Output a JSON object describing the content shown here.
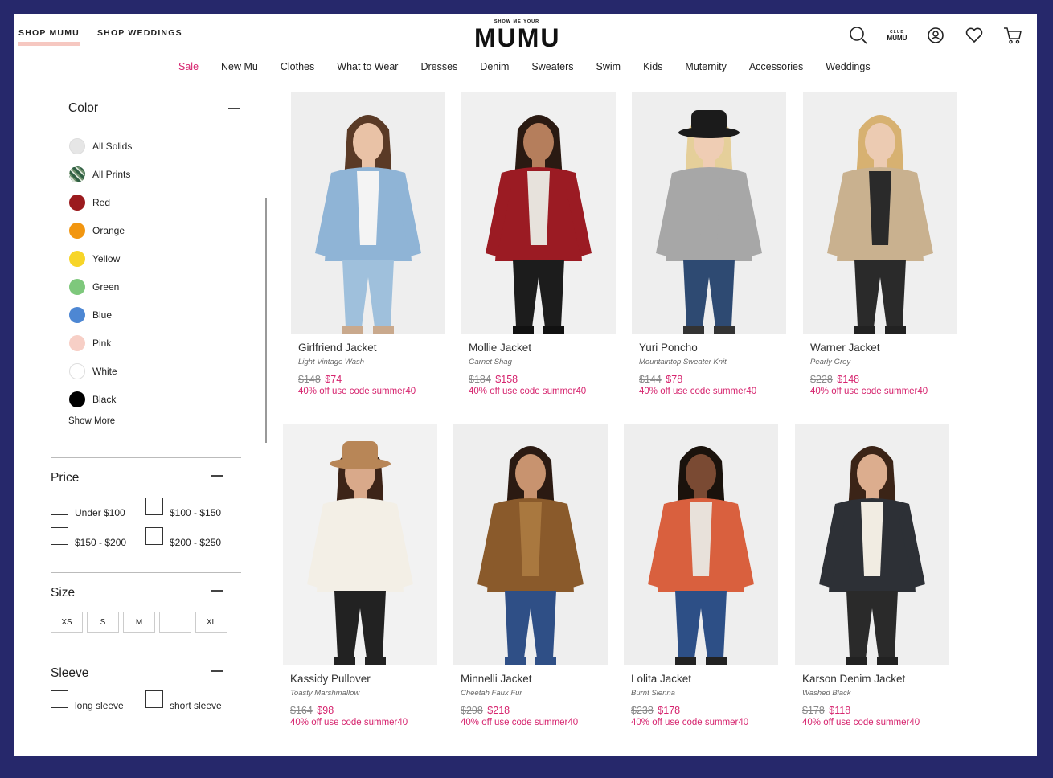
{
  "header": {
    "top_links": [
      {
        "label": "SHOP MUMU",
        "active": true
      },
      {
        "label": "SHOP WEDDINGS",
        "active": false
      }
    ],
    "logo": {
      "small": "SHOW ME YOUR",
      "big": "MUMU"
    },
    "club": {
      "small": "CLUB",
      "big": "MUMU"
    },
    "icons": [
      "search-icon",
      "club-mumu-icon",
      "account-icon",
      "heart-icon",
      "cart-icon"
    ],
    "nav": [
      "Sale",
      "New Mu",
      "Clothes",
      "What to Wear",
      "Dresses",
      "Denim",
      "Sweaters",
      "Swim",
      "Kids",
      "Muternity",
      "Accessories",
      "Weddings"
    ]
  },
  "filters": {
    "color": {
      "title": "Color",
      "options": [
        {
          "label": "All Solids",
          "swatch": "#e6e6e6"
        },
        {
          "label": "All Prints",
          "swatch": "print"
        },
        {
          "label": "Red",
          "swatch": "#9b1b1e"
        },
        {
          "label": "Orange",
          "swatch": "#f29610"
        },
        {
          "label": "Yellow",
          "swatch": "#f7d528"
        },
        {
          "label": "Green",
          "swatch": "#7ec87c"
        },
        {
          "label": "Blue",
          "swatch": "#4d87d3"
        },
        {
          "label": "Pink",
          "swatch": "#f7cfc6"
        },
        {
          "label": "White",
          "swatch": "#ffffff"
        },
        {
          "label": "Black",
          "swatch": "#000000"
        }
      ],
      "show_more": "Show More"
    },
    "price": {
      "title": "Price",
      "options": [
        "Under $100",
        "$100 - $150",
        "$150 - $200",
        "$200 - $250"
      ]
    },
    "size": {
      "title": "Size",
      "options": [
        "XS",
        "S",
        "M",
        "L",
        "XL"
      ]
    },
    "sleeve": {
      "title": "Sleeve",
      "options": [
        "long sleeve",
        "short sleeve"
      ]
    }
  },
  "products": [
    {
      "name": "Girlfriend Jacket",
      "variant": "Light Vintage Wash",
      "old_price": "$148",
      "price": "$74",
      "promo": "40% off use code summer40",
      "image": "light-wash-denim-jacket"
    },
    {
      "name": "Mollie Jacket",
      "variant": "Garnet Shag",
      "old_price": "$184",
      "price": "$158",
      "promo": "40% off use code summer40",
      "image": "red-fringe-jacket"
    },
    {
      "name": "Yuri Poncho",
      "variant": "Mountaintop Sweater Knit",
      "old_price": "$144",
      "price": "$78",
      "promo": "40% off use code summer40",
      "image": "grey-knit-poncho"
    },
    {
      "name": "Warner Jacket",
      "variant": "Pearly Grey",
      "old_price": "$228",
      "price": "$148",
      "promo": "40% off use code summer40",
      "image": "faux-fur-coat"
    },
    {
      "name": "Kassidy Pullover",
      "variant": "Toasty Marshmallow",
      "old_price": "$164",
      "price": "$98",
      "promo": "40% off use code summer40",
      "image": "white-sherpa-pullover"
    },
    {
      "name": "Minnelli Jacket",
      "variant": "Cheetah Faux Fur",
      "old_price": "$298",
      "price": "$218",
      "promo": "40% off use code summer40",
      "image": "cheetah-print-coat"
    },
    {
      "name": "Lolita Jacket",
      "variant": "Burnt Sienna",
      "old_price": "$238",
      "price": "$178",
      "promo": "40% off use code summer40",
      "image": "orange-long-coat"
    },
    {
      "name": "Karson Denim Jacket",
      "variant": "Washed Black",
      "old_price": "$178",
      "price": "$118",
      "promo": "40% off use code summer40",
      "image": "black-sherpa-denim-jacket"
    }
  ]
}
